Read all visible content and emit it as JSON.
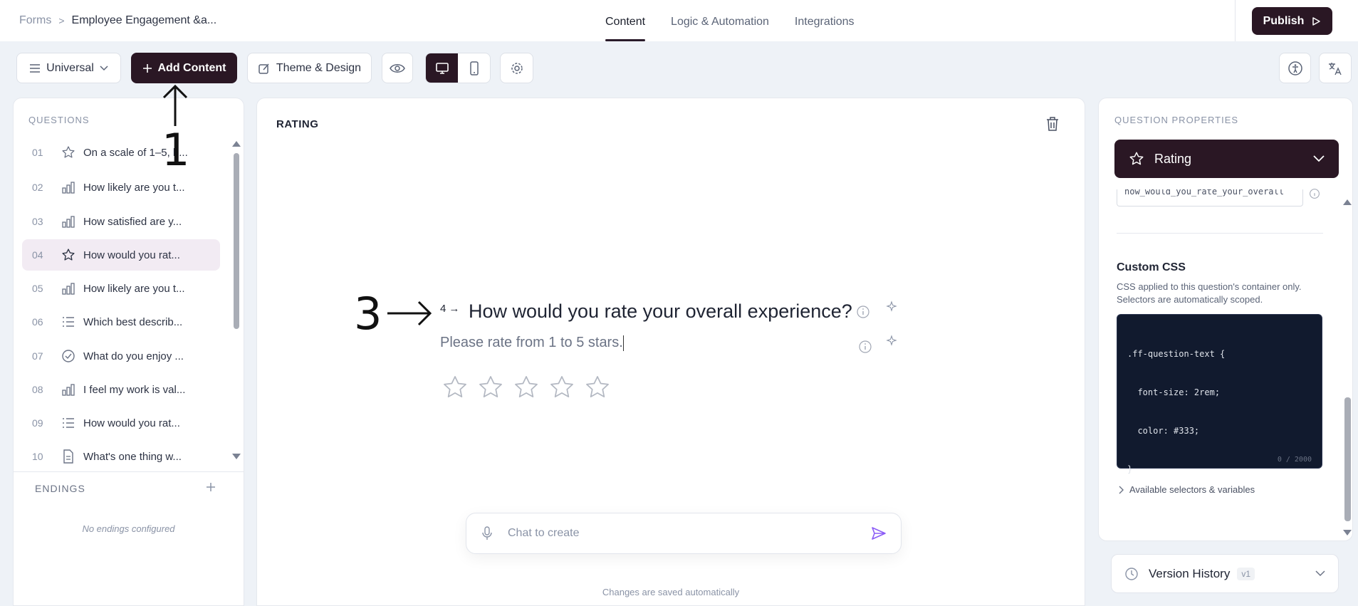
{
  "breadcrumb": {
    "root": "Forms",
    "separator": ">",
    "current": "Employee Engagement &a..."
  },
  "nav": {
    "tabs": [
      {
        "label": "Content"
      },
      {
        "label": "Logic & Automation"
      },
      {
        "label": "Integrations"
      }
    ]
  },
  "publish": {
    "label": "Publish"
  },
  "toolbar": {
    "universal": "Universal",
    "add_content": "Add Content",
    "theme_design": "Theme & Design"
  },
  "questions_panel": {
    "title": "QUESTIONS",
    "items": [
      {
        "num": "01",
        "icon": "star-icon",
        "label": "On a scale of 1–5, h..."
      },
      {
        "num": "02",
        "icon": "bar-chart-icon",
        "label": "How likely are you t..."
      },
      {
        "num": "03",
        "icon": "bar-chart-icon",
        "label": "How satisfied are y..."
      },
      {
        "num": "04",
        "icon": "star-icon",
        "label": "How would you rat..."
      },
      {
        "num": "05",
        "icon": "bar-chart-icon",
        "label": "How likely are you t..."
      },
      {
        "num": "06",
        "icon": "list-icon",
        "label": "Which best describ..."
      },
      {
        "num": "07",
        "icon": "check-circle-icon",
        "label": "What do you enjoy ..."
      },
      {
        "num": "08",
        "icon": "bar-chart-icon",
        "label": "I feel my work is val..."
      },
      {
        "num": "09",
        "icon": "list-icon",
        "label": "How would you rat..."
      },
      {
        "num": "10",
        "icon": "document-icon",
        "label": "What's one thing w..."
      }
    ],
    "endings_title": "ENDINGS",
    "no_endings": "No endings configured"
  },
  "annotations": {
    "arrow_1": "1",
    "arrow_3": "3"
  },
  "editor": {
    "section_label": "RATING",
    "question_number": "4",
    "question_arrow": "→",
    "question_text": "How would you rate your overall experience?",
    "description": "Please rate from 1 to 5 stars.",
    "rating": {
      "max": 5
    },
    "chat_placeholder": "Chat to create",
    "saved_note": "Changes are saved automatically"
  },
  "properties": {
    "title": "QUESTION PROPERTIES",
    "type_label": "Rating",
    "field_id": "how_would_you_rate_your_overall",
    "custom_css_title": "Custom CSS",
    "custom_css_desc_1": "CSS applied to this question's container only.",
    "custom_css_desc_2": "Selectors are automatically scoped.",
    "css_line_1": ".ff-question-text {",
    "css_line_2": "  font-size: 2rem;",
    "css_line_3": "  color: #333;",
    "css_line_4": "}",
    "char_count": "0 / 2000",
    "selectors_link": "Available selectors & variables",
    "version_history": "Version History",
    "version_badge": "v1"
  },
  "colors": {
    "brand_dark": "#2a1724",
    "selected_bg": "#f2ebf3",
    "code_bg": "#111a2e",
    "accent_purple": "#8b5cf6"
  }
}
